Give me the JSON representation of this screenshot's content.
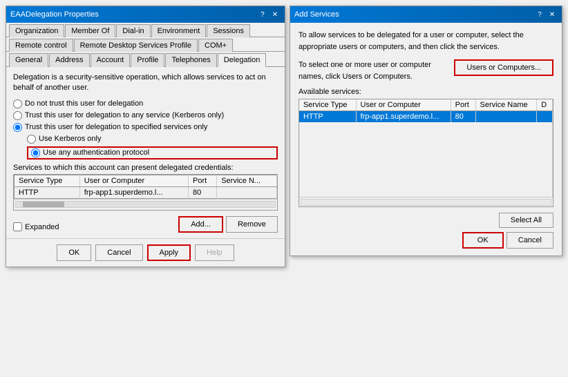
{
  "main_dialog": {
    "title": "EAADelegation Properties",
    "tabs_row1": [
      {
        "label": "Organization",
        "active": false
      },
      {
        "label": "Member Of",
        "active": false
      },
      {
        "label": "Dial-in",
        "active": false
      },
      {
        "label": "Environment",
        "active": false
      },
      {
        "label": "Sessions",
        "active": false
      }
    ],
    "tabs_row2": [
      {
        "label": "Remote control",
        "active": false
      },
      {
        "label": "Remote Desktop Services Profile",
        "active": false
      },
      {
        "label": "COM+",
        "active": false
      }
    ],
    "tabs_row3": [
      {
        "label": "General",
        "active": false
      },
      {
        "label": "Address",
        "active": false
      },
      {
        "label": "Account",
        "active": false
      },
      {
        "label": "Profile",
        "active": false
      },
      {
        "label": "Telephones",
        "active": false
      },
      {
        "label": "Delegation",
        "active": true
      }
    ],
    "description": "Delegation is a security-sensitive operation, which allows services to act on behalf of another user.",
    "radio_options": [
      {
        "id": "r1",
        "label": "Do not trust this user for delegation",
        "checked": false,
        "indented": false
      },
      {
        "id": "r2",
        "label": "Trust this user for delegation to any service (Kerberos only)",
        "checked": false,
        "indented": false
      },
      {
        "id": "r3",
        "label": "Trust this user for delegation to specified services only",
        "checked": true,
        "indented": false
      },
      {
        "id": "r4",
        "label": "Use Kerberos only",
        "checked": false,
        "indented": true
      },
      {
        "id": "r5",
        "label": "Use any authentication protocol",
        "checked": true,
        "indented": true,
        "highlighted": true
      }
    ],
    "services_label": "Services to which this account can present delegated credentials:",
    "table_headers": [
      "Service Type",
      "User or Computer",
      "Port",
      "Service N..."
    ],
    "table_rows": [
      {
        "service_type": "HTTP",
        "user_computer": "frp-app1.superdemo.l...",
        "port": "80",
        "service_name": "",
        "selected": false
      }
    ],
    "checkbox_label": "Expanded",
    "add_button": "Add...",
    "remove_button": "Remove",
    "footer_buttons": [
      "OK",
      "Cancel",
      "Apply",
      "Help"
    ],
    "apply_highlighted": true
  },
  "add_services_dialog": {
    "title": "Add Services",
    "description1": "To allow services to be delegated for a user or computer, select the appropriate users or computers, and then click the services.",
    "description2": "To select one or more user or computer names, click Users or Computers.",
    "users_computers_button": "Users or Computers...",
    "available_label": "Available services:",
    "table_headers": [
      "Service Type",
      "User or Computer",
      "Port",
      "Service Name",
      "D"
    ],
    "table_rows": [
      {
        "service_type": "HTTP",
        "user_computer": "frp-app1.superdemo.l...",
        "port": "80",
        "service_name": "",
        "d": "",
        "selected": true
      }
    ],
    "select_all_button": "Select All",
    "ok_button": "OK",
    "cancel_button": "Cancel",
    "ok_highlighted": true
  },
  "icons": {
    "minimize": "─",
    "maximize": "□",
    "close": "✕",
    "help": "?"
  }
}
